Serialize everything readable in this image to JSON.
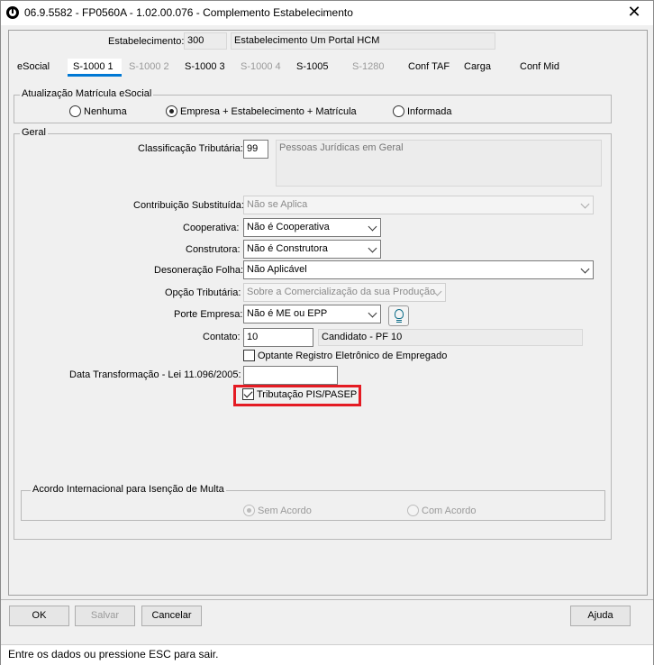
{
  "window": {
    "title": "06.9.5582 - FP0560A - 1.02.00.076 - Complemento Estabelecimento",
    "close_glyph": "✕"
  },
  "header": {
    "estabelecimento_label": "Estabelecimento:",
    "estabelecimento_code": "300",
    "estabelecimento_name": "Estabelecimento Um Portal HCM"
  },
  "tabs": [
    {
      "label": "eSocial",
      "state": "normal"
    },
    {
      "label": "S-1000 1",
      "state": "active"
    },
    {
      "label": "S-1000 2",
      "state": "disabled"
    },
    {
      "label": "S-1000 3",
      "state": "normal"
    },
    {
      "label": "S-1000 4",
      "state": "disabled"
    },
    {
      "label": "S-1005",
      "state": "normal"
    },
    {
      "label": "S-1280",
      "state": "disabled"
    },
    {
      "label": "Conf TAF",
      "state": "normal"
    },
    {
      "label": "Carga",
      "state": "normal"
    },
    {
      "label": "Conf Mid",
      "state": "normal"
    }
  ],
  "atualizacao": {
    "title": "Atualização Matrícula eSocial",
    "options": [
      "Nenhuma",
      "Empresa + Estabelecimento + Matrícula",
      "Informada"
    ],
    "selected": "Empresa + Estabelecimento + Matrícula"
  },
  "geral": {
    "title": "Geral",
    "classificacao_label": "Classificação Tributária:",
    "classificacao_code": "99",
    "classificacao_desc": "Pessoas Jurídicas em Geral",
    "contribuicao_label": "Contribuição Substituída:",
    "contribuicao_value": "Não se Aplica",
    "cooperativa_label": "Cooperativa:",
    "cooperativa_value": "Não é Cooperativa",
    "construtora_label": "Construtora:",
    "construtora_value": "Não é Construtora",
    "desoneracao_label": "Desoneração Folha:",
    "desoneracao_value": "Não Aplicável",
    "opcao_label": "Opção Tributária:",
    "opcao_value": "Sobre a Comercialização da sua Produção",
    "porte_label": "Porte Empresa:",
    "porte_value": "Não é ME ou EPP",
    "contato_label": "Contato:",
    "contato_code": "10",
    "contato_name": "Candidato -  PF 10",
    "optante_label": "Optante Registro Eletrônico de Empregado",
    "optante_checked": false,
    "data_label": "Data Transformação - Lei 11.096/2005:",
    "data_value": "",
    "pis_label": "Tributação PIS/PASEP",
    "pis_checked": true
  },
  "acordo": {
    "title": "Acordo Internacional para Isenção de Multa",
    "options": [
      "Sem Acordo",
      "Com Acordo"
    ],
    "selected": "Sem Acordo"
  },
  "buttons": {
    "ok": "OK",
    "salvar": "Salvar",
    "cancelar": "Cancelar",
    "ajuda": "Ajuda"
  },
  "status_text": "Entre os dados ou pressione ESC para sair.",
  "colors": {
    "active_tab_accent": "#0078d4",
    "highlight": "#e41b23"
  }
}
